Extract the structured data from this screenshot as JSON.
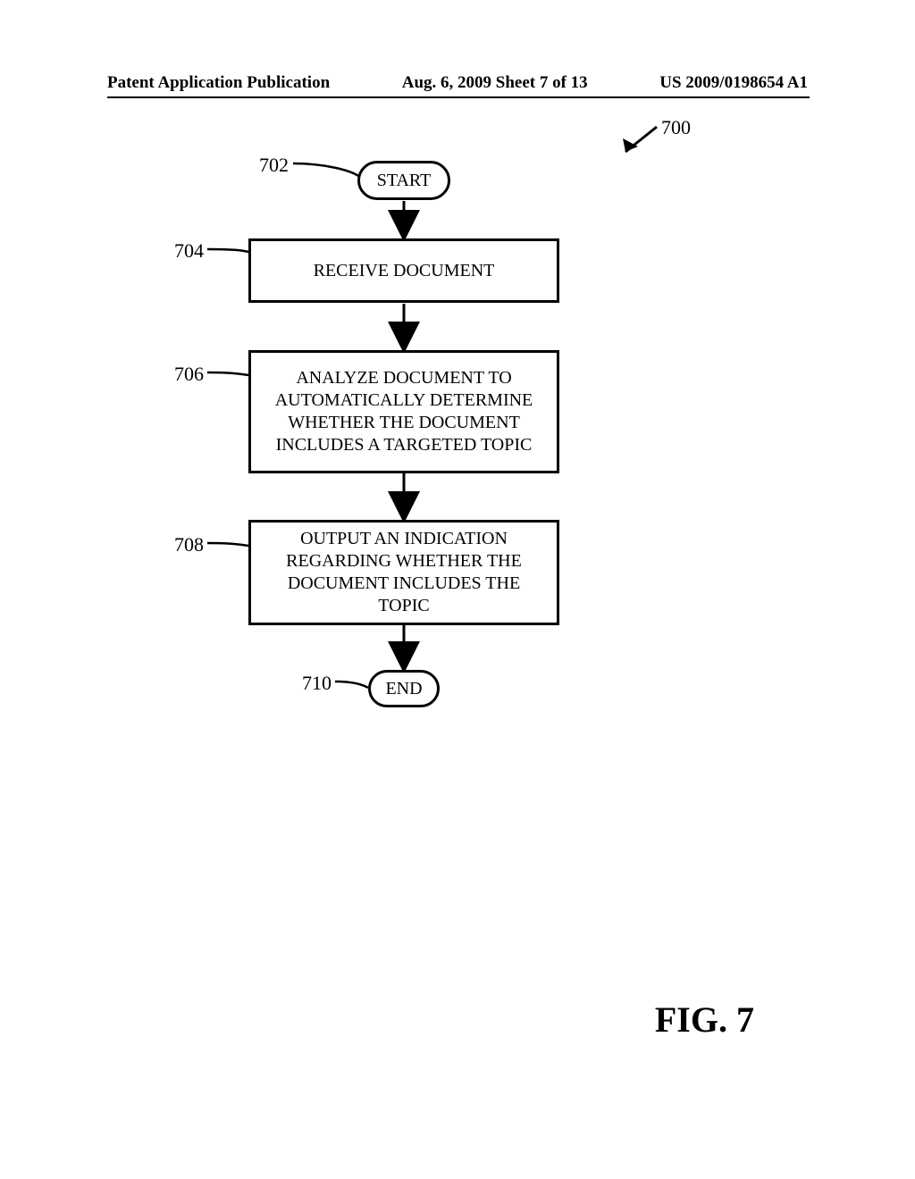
{
  "header": {
    "left": "Patent Application Publication",
    "center": "Aug. 6, 2009   Sheet 7 of 13",
    "right": "US 2009/0198654 A1"
  },
  "refs": {
    "r700": "700",
    "r702": "702",
    "r704": "704",
    "r706": "706",
    "r708": "708",
    "r710": "710"
  },
  "nodes": {
    "start": "START",
    "receive": "RECEIVE DOCUMENT",
    "analyze": "ANALYZE DOCUMENT TO AUTOMATICALLY DETERMINE WHETHER THE DOCUMENT INCLUDES A TARGETED TOPIC",
    "output": "OUTPUT AN INDICATION REGARDING WHETHER THE DOCUMENT INCLUDES THE TOPIC",
    "end": "END"
  },
  "figure": "FIG. 7"
}
